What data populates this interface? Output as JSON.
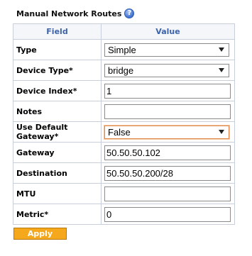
{
  "title": "Manual Network Routes",
  "help_icon": "question-mark-icon",
  "columns": {
    "field": "Field",
    "value": "Value"
  },
  "rows": [
    {
      "label": "Type",
      "kind": "select",
      "value": "Simple"
    },
    {
      "label": "Device Type*",
      "kind": "select",
      "value": "bridge"
    },
    {
      "label": "Device Index*",
      "kind": "input",
      "value": "1"
    },
    {
      "label": "Notes",
      "kind": "input",
      "value": ""
    },
    {
      "label": "Use Default Gateway*",
      "kind": "select",
      "value": "False",
      "focused": true
    },
    {
      "label": "Gateway",
      "kind": "input",
      "value": "50.50.50.102"
    },
    {
      "label": "Destination",
      "kind": "input",
      "value": "50.50.50.200/28"
    },
    {
      "label": "MTU",
      "kind": "input",
      "value": ""
    },
    {
      "label": "Metric*",
      "kind": "input",
      "value": "0"
    }
  ],
  "apply_label": "Apply"
}
